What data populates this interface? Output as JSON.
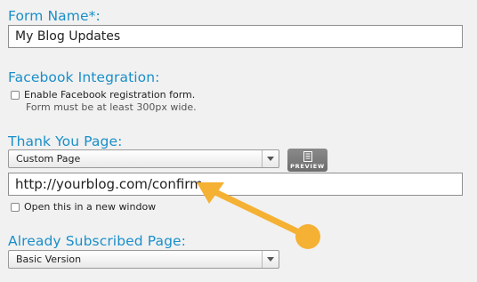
{
  "form_name": {
    "label": "Form Name*:",
    "value": "My Blog Updates"
  },
  "facebook": {
    "label": "Facebook Integration:",
    "checkbox_label": "Enable Facebook registration form.",
    "hint": "Form must be at least 300px wide.",
    "checked": false
  },
  "thank_you": {
    "label": "Thank You Page:",
    "select_value": "Custom Page",
    "preview_label": "PREVIEW",
    "url_value": "http://yourblog.com/confirm",
    "new_window_label": "Open this in a new window",
    "new_window_checked": false
  },
  "already_subscribed": {
    "label": "Already Subscribed Page:",
    "select_value": "Basic Version"
  },
  "colors": {
    "label": "#1a8fc9",
    "annotation_arrow": "#f5b133",
    "background": "#f1f1f1"
  },
  "icons": [
    "document-icon",
    "chevron-down-icon",
    "annotation-arrow-icon"
  ]
}
